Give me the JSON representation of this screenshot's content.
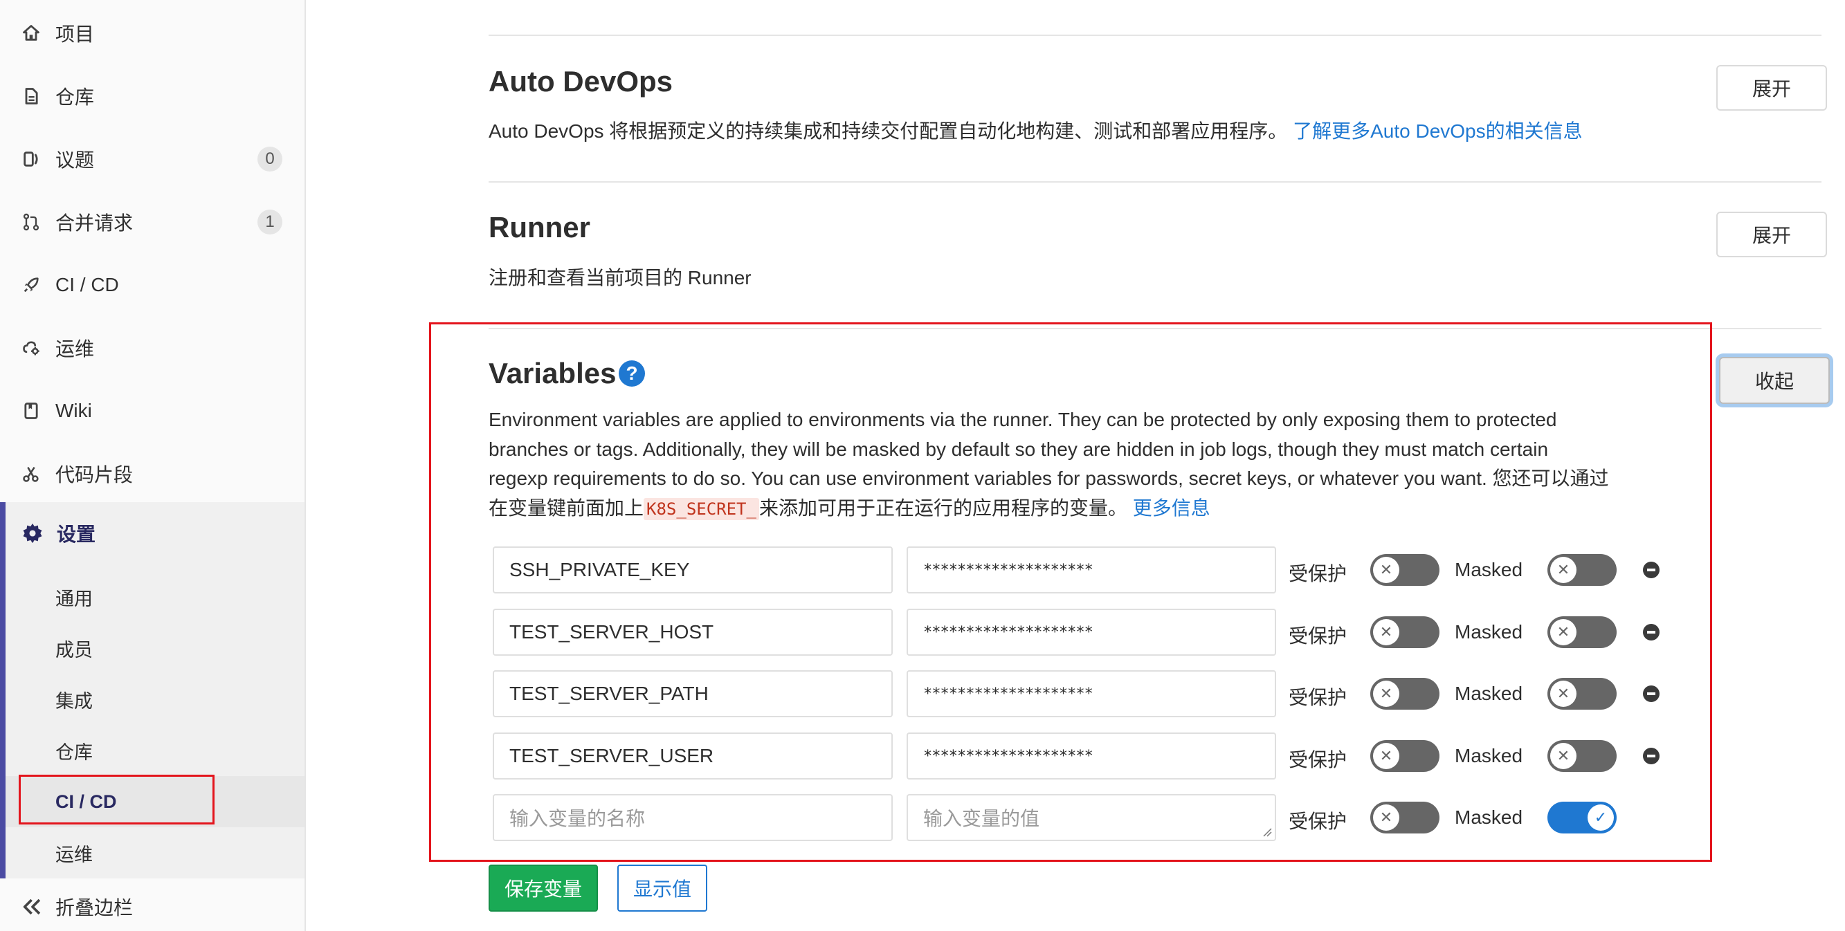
{
  "sidebar": {
    "items": [
      {
        "label": "项目",
        "icon": "home-icon"
      },
      {
        "label": "仓库",
        "icon": "document-icon"
      },
      {
        "label": "议题",
        "icon": "issues-icon",
        "badge": "0"
      },
      {
        "label": "合并请求",
        "icon": "merge-request-icon",
        "badge": "1"
      },
      {
        "label": "CI / CD",
        "icon": "rocket-icon"
      },
      {
        "label": "运维",
        "icon": "cloud-gear-icon"
      },
      {
        "label": "Wiki",
        "icon": "book-icon"
      },
      {
        "label": "代码片段",
        "icon": "scissors-icon"
      }
    ],
    "settings": {
      "label": "设置",
      "icon": "gear-icon",
      "subitems": [
        "通用",
        "成员",
        "集成",
        "仓库",
        "CI / CD",
        "运维"
      ],
      "active": "CI / CD"
    },
    "collapse_label": "折叠边栏"
  },
  "sections": {
    "auto_devops": {
      "title": "Auto DevOps",
      "desc": "Auto DevOps 将根据预定义的持续集成和持续交付配置自动化地构建、测试和部署应用程序。",
      "link": "了解更多Auto DevOps的相关信息",
      "button": "展开"
    },
    "runner": {
      "title": "Runner",
      "desc": "注册和查看当前项目的 Runner",
      "button": "展开"
    },
    "variables": {
      "title": "Variables",
      "help_icon": "?",
      "button": "收起",
      "desc_line1": "Environment variables are applied to environments via the runner. They can be protected by only exposing them to protected",
      "desc_line2": "branches or tags. Additionally, they will be masked by default so they are hidden in job logs, though they must match certain",
      "desc_line3": "regexp requirements to do so. You can use environment variables for passwords, secret keys, or whatever you want. 您还可以通过",
      "desc_line4_pre": "在变量键前面加上",
      "desc_code": "K8S_SECRET_",
      "desc_line4_post": "来添加可用于正在运行的应用程序的变量。",
      "more_link": "更多信息",
      "rows": [
        {
          "key": "SSH_PRIVATE_KEY",
          "value": "********************",
          "protected_label": "受保护",
          "masked_label": "Masked"
        },
        {
          "key": "TEST_SERVER_HOST",
          "value": "********************",
          "protected_label": "受保护",
          "masked_label": "Masked"
        },
        {
          "key": "TEST_SERVER_PATH",
          "value": "********************",
          "protected_label": "受保护",
          "masked_label": "Masked"
        },
        {
          "key": "TEST_SERVER_USER",
          "value": "********************",
          "protected_label": "受保护",
          "masked_label": "Masked"
        }
      ],
      "new_row": {
        "key_placeholder": "输入变量的名称",
        "value_placeholder": "输入变量的值",
        "protected_label": "受保护",
        "masked_label": "Masked"
      },
      "save_button": "保存变量",
      "reveal_button": "显示值"
    }
  },
  "colors": {
    "accent_blue": "#1f78d1",
    "save_green": "#1aaa55",
    "highlight_red": "#e3141c",
    "sidebar_active": "#4b4ba3"
  }
}
